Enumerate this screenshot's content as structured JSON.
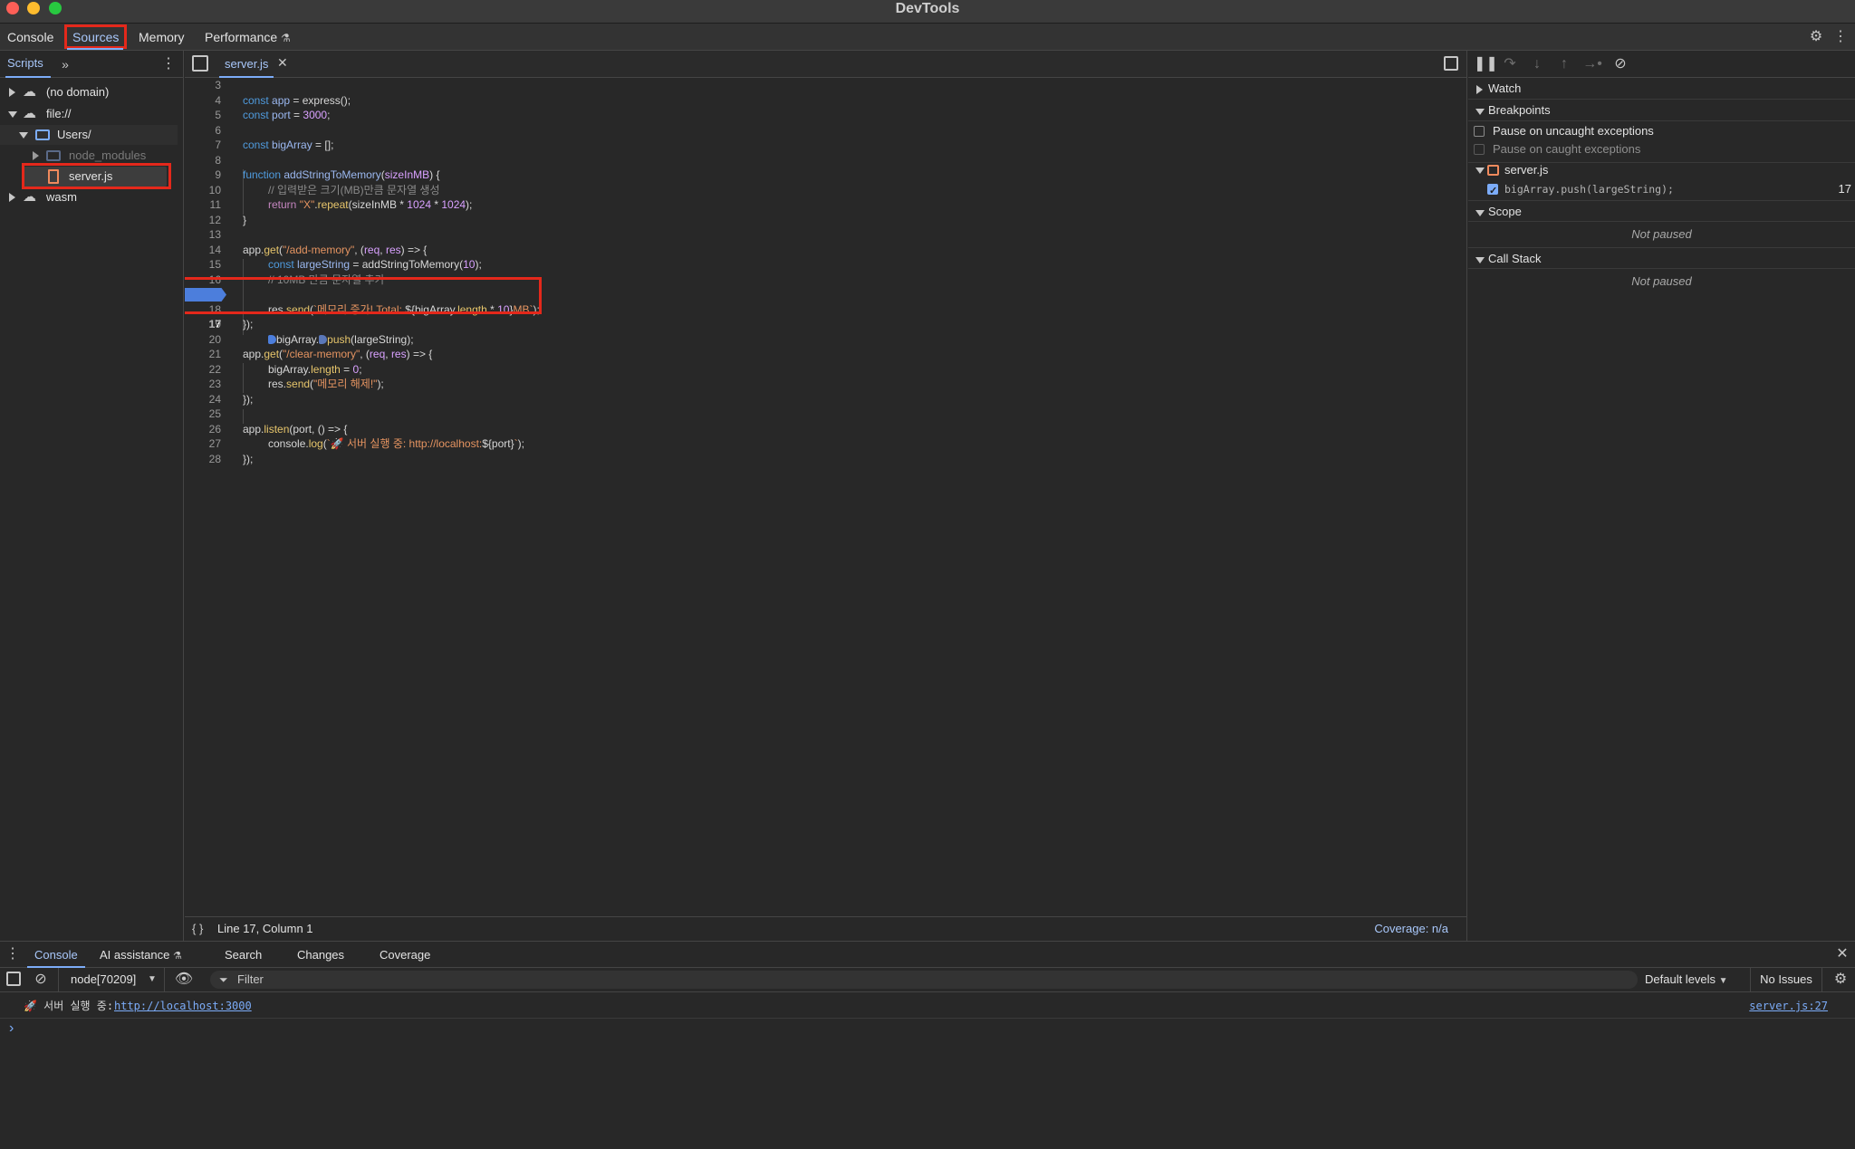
{
  "window": {
    "title": "DevTools"
  },
  "main_tabs": [
    {
      "label": "Console"
    },
    {
      "label": "Sources"
    },
    {
      "label": "Memory"
    },
    {
      "label": "Performance"
    }
  ],
  "navigator": {
    "tab_label": "Scripts",
    "tree": [
      {
        "label": "(no domain)"
      },
      {
        "label": "file://"
      },
      {
        "label": "Users/"
      },
      {
        "label": "node_modules"
      },
      {
        "label": "server.js"
      },
      {
        "label": "wasm"
      }
    ]
  },
  "editor": {
    "open_file": "server.js",
    "breakpoint_line": "17",
    "lines": [
      {
        "n": "3"
      },
      {
        "n": "4"
      },
      {
        "n": "5"
      },
      {
        "n": "6"
      },
      {
        "n": "7"
      },
      {
        "n": "8"
      },
      {
        "n": "9"
      },
      {
        "n": "10"
      },
      {
        "n": "11"
      },
      {
        "n": "12"
      },
      {
        "n": "13"
      },
      {
        "n": "14"
      },
      {
        "n": "15"
      },
      {
        "n": "16"
      },
      {
        "n": "17"
      },
      {
        "n": "18"
      },
      {
        "n": "19"
      },
      {
        "n": "20"
      },
      {
        "n": "21"
      },
      {
        "n": "22"
      },
      {
        "n": "23"
      },
      {
        "n": "24"
      },
      {
        "n": "25"
      },
      {
        "n": "26"
      },
      {
        "n": "27"
      },
      {
        "n": "28"
      }
    ],
    "code": {
      "l4_a": "const",
      "l4_b": "app",
      "l4_c": " = express();",
      "l5_a": "const",
      "l5_b": "port",
      "l5_c": " = ",
      "l5_d": "3000",
      "l5_e": ";",
      "l7_a": "const",
      "l7_b": "bigArray",
      "l7_c": " = [];",
      "l9_a": "function",
      "l9_b": "addStringToMemory",
      "l9_c": "(",
      "l9_d": "sizeInMB",
      "l9_e": ") {",
      "l10": "// 입력받은 크기(MB)만큼 문자열 생성",
      "l11_a": "return",
      "l11_b": "\"X\"",
      "l11_c": ".",
      "l11_d": "repeat",
      "l11_e": "(sizeInMB * ",
      "l11_f": "1024",
      "l11_g": " * ",
      "l11_h": "1024",
      "l11_i": ");",
      "l12": "}",
      "l14_a": "app.",
      "l14_b": "get",
      "l14_c": "(",
      "l14_d": "\"/add-memory\"",
      "l14_e": ", (",
      "l14_f": "req",
      "l14_g": ", ",
      "l14_h": "res",
      "l14_i": ") => {",
      "l15_a": "const",
      "l15_b": "largeString",
      "l15_c": " = addStringToMemory(",
      "l15_d": "10",
      "l15_e": ");",
      "l16": "// 10MB 만큼 문자열 추가",
      "l17_a": "bigArray.",
      "l17_b": "push",
      "l17_c": "(largeString);",
      "l18_a": "res.",
      "l18_b": "send",
      "l18_c": "(",
      "l18_d": "`메모리 증가! Total: ",
      "l18_e": "${bigArray.",
      "l18_f": "length",
      "l18_g": " * ",
      "l18_h": "10",
      "l18_i": "}",
      "l18_j": "MB`",
      "l18_k": ");",
      "l19": "});",
      "l21_a": "app.",
      "l21_b": "get",
      "l21_c": "(",
      "l21_d": "\"/clear-memory\"",
      "l21_e": ", (",
      "l21_f": "req",
      "l21_g": ", ",
      "l21_h": "res",
      "l21_i": ") => {",
      "l22_a": "bigArray.",
      "l22_b": "length",
      "l22_c": " = ",
      "l22_d": "0",
      "l22_e": ";",
      "l23_a": "res.",
      "l23_b": "send",
      "l23_c": "(",
      "l23_d": "\"메모리 해제!\"",
      "l23_e": ");",
      "l24": "});",
      "l26_a": "app.",
      "l26_b": "listen",
      "l26_c": "(port, () => {",
      "l27_a": "console.",
      "l27_b": "log",
      "l27_c": "(",
      "l27_d": "`🚀 서버 실행 중: http://localhost:",
      "l27_e": "${port}",
      "l27_f": "`",
      "l27_g": ");",
      "l28": "});"
    },
    "status": {
      "position": "Line 17, Column 1",
      "coverage": "Coverage: n/a"
    }
  },
  "debugger": {
    "watch_label": "Watch",
    "breakpoints_label": "Breakpoints",
    "pause_uncaught": "Pause on uncaught exceptions",
    "pause_caught": "Pause on caught exceptions",
    "bp_file": "server.js",
    "bp_code": "bigArray.push(largeString);",
    "bp_line": "17",
    "scope_label": "Scope",
    "scope_status": "Not paused",
    "callstack_label": "Call Stack",
    "callstack_status": "Not paused"
  },
  "drawer": {
    "tabs": [
      {
        "label": "Console"
      },
      {
        "label": "AI assistance"
      },
      {
        "label": "Search"
      },
      {
        "label": "Changes"
      },
      {
        "label": "Coverage"
      }
    ],
    "context": "node[70209]",
    "filter_placeholder": "Filter",
    "levels": "Default levels",
    "issues": "No Issues",
    "message_text": "🚀 서버 실행 중: ",
    "message_link": "http://localhost:3000",
    "message_source": "server.js:27",
    "prompt": "›"
  },
  "colors": {
    "accent": "#7cacf8",
    "breakpoint": "#4c7edc",
    "highlight_box": "#e4281b",
    "background": "#282828"
  }
}
